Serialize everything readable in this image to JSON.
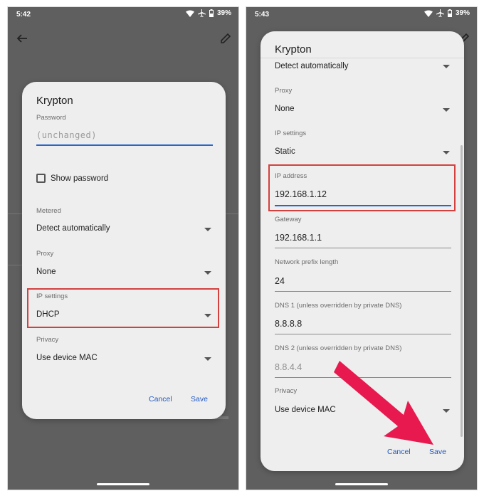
{
  "left_screen": {
    "status": {
      "time": "5:42",
      "battery": "39%"
    },
    "dialog": {
      "title": "Krypton",
      "password": {
        "label": "Password",
        "placeholder": "(unchanged)"
      },
      "show_password": "Show password",
      "metered": {
        "label": "Metered",
        "value": "Detect automatically"
      },
      "proxy": {
        "label": "Proxy",
        "value": "None"
      },
      "ip_settings": {
        "label": "IP settings",
        "value": "DHCP"
      },
      "privacy": {
        "label": "Privacy",
        "value": "Use device MAC"
      },
      "cancel": "Cancel",
      "save": "Save"
    }
  },
  "right_screen": {
    "status": {
      "time": "5:43",
      "battery": "39%"
    },
    "dialog": {
      "title": "Krypton",
      "metered_value": "Detect automatically",
      "proxy": {
        "label": "Proxy",
        "value": "None"
      },
      "ip_settings": {
        "label": "IP settings",
        "value": "Static"
      },
      "ip_address": {
        "label": "IP address",
        "value": "192.168.1.12"
      },
      "gateway": {
        "label": "Gateway",
        "value": "192.168.1.1"
      },
      "prefix": {
        "label": "Network prefix length",
        "value": "24"
      },
      "dns1": {
        "label": "DNS 1 (unless overridden by private DNS)",
        "value": "8.8.8.8"
      },
      "dns2": {
        "label": "DNS 2 (unless overridden by private DNS)",
        "placeholder": "8.8.4.4"
      },
      "privacy": {
        "label": "Privacy",
        "value": "Use device MAC"
      },
      "cancel": "Cancel",
      "save": "Save"
    }
  },
  "icons": {
    "wifi": "wifi-icon",
    "airplane": "airplane-icon",
    "battery": "battery-icon",
    "back": "arrow-back-icon",
    "edit": "pencil-icon"
  },
  "colors": {
    "accent": "#2a66c9",
    "highlight": "#d2403f",
    "annotation_arrow": "#e8194f"
  }
}
